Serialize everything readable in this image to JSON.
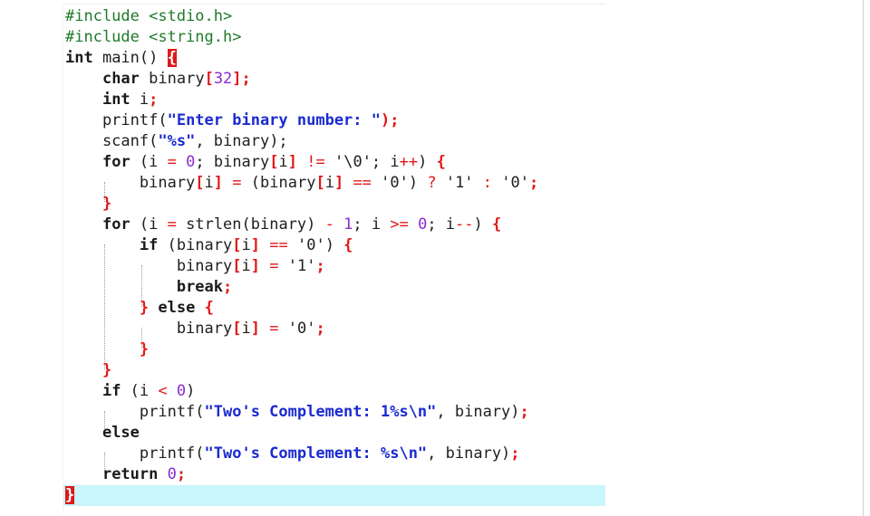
{
  "editor": {
    "lines": [
      [
        {
          "t": "#include <stdio.h>",
          "c": "pp"
        }
      ],
      [
        {
          "t": "#include <string.h>",
          "c": "pp"
        }
      ],
      [
        {
          "t": "int",
          "c": "kw"
        },
        {
          "t": " main() "
        },
        {
          "t": "{",
          "c": "brace-match"
        }
      ],
      [
        {
          "t": "    "
        },
        {
          "t": "char",
          "c": "kw"
        },
        {
          "t": " binary"
        },
        {
          "t": "[",
          "c": "br"
        },
        {
          "t": "32",
          "c": "num"
        },
        {
          "t": "];",
          "c": "br"
        }
      ],
      [
        {
          "t": "    "
        },
        {
          "t": "int",
          "c": "kw"
        },
        {
          "t": " i"
        },
        {
          "t": ";",
          "c": "br"
        }
      ],
      [
        {
          "t": "    printf("
        },
        {
          "t": "\"Enter binary number: \"",
          "c": "str"
        },
        {
          "t": ");",
          "c": "br"
        }
      ],
      [
        {
          "t": "    scanf("
        },
        {
          "t": "\"%s\"",
          "c": "str"
        },
        {
          "t": ", binary);"
        }
      ],
      [
        {
          "t": "    "
        },
        {
          "t": "for",
          "c": "kw"
        },
        {
          "t": " (i "
        },
        {
          "t": "=",
          "c": "op"
        },
        {
          "t": " "
        },
        {
          "t": "0",
          "c": "num"
        },
        {
          "t": "; binary"
        },
        {
          "t": "[",
          "c": "br"
        },
        {
          "t": "i"
        },
        {
          "t": "]",
          "c": "br"
        },
        {
          "t": " "
        },
        {
          "t": "!=",
          "c": "op"
        },
        {
          "t": " '\\0'; i"
        },
        {
          "t": "++",
          "c": "op"
        },
        {
          "t": ") "
        },
        {
          "t": "{",
          "c": "br"
        }
      ],
      [
        {
          "t": "        binary"
        },
        {
          "t": "[",
          "c": "br"
        },
        {
          "t": "i"
        },
        {
          "t": "]",
          "c": "br"
        },
        {
          "t": " "
        },
        {
          "t": "=",
          "c": "op"
        },
        {
          "t": " (binary"
        },
        {
          "t": "[",
          "c": "br"
        },
        {
          "t": "i"
        },
        {
          "t": "]",
          "c": "br"
        },
        {
          "t": " "
        },
        {
          "t": "==",
          "c": "op"
        },
        {
          "t": " '0') "
        },
        {
          "t": "?",
          "c": "op"
        },
        {
          "t": " '1' "
        },
        {
          "t": ":",
          "c": "op"
        },
        {
          "t": " '0'"
        },
        {
          "t": ";",
          "c": "br"
        }
      ],
      [
        {
          "t": "    "
        },
        {
          "t": "}",
          "c": "br"
        }
      ],
      [
        {
          "t": "    "
        },
        {
          "t": "for",
          "c": "kw"
        },
        {
          "t": " (i "
        },
        {
          "t": "=",
          "c": "op"
        },
        {
          "t": " strlen(binary) "
        },
        {
          "t": "-",
          "c": "op"
        },
        {
          "t": " "
        },
        {
          "t": "1",
          "c": "num"
        },
        {
          "t": "; i "
        },
        {
          "t": ">=",
          "c": "op"
        },
        {
          "t": " "
        },
        {
          "t": "0",
          "c": "num"
        },
        {
          "t": "; i"
        },
        {
          "t": "--",
          "c": "op"
        },
        {
          "t": ") "
        },
        {
          "t": "{",
          "c": "br"
        }
      ],
      [
        {
          "t": "        "
        },
        {
          "t": "if",
          "c": "kw"
        },
        {
          "t": " (binary"
        },
        {
          "t": "[",
          "c": "br"
        },
        {
          "t": "i"
        },
        {
          "t": "]",
          "c": "br"
        },
        {
          "t": " "
        },
        {
          "t": "==",
          "c": "op"
        },
        {
          "t": " '0') "
        },
        {
          "t": "{",
          "c": "br"
        }
      ],
      [
        {
          "t": "            binary"
        },
        {
          "t": "[",
          "c": "br"
        },
        {
          "t": "i"
        },
        {
          "t": "]",
          "c": "br"
        },
        {
          "t": " "
        },
        {
          "t": "=",
          "c": "op"
        },
        {
          "t": " '1'"
        },
        {
          "t": ";",
          "c": "br"
        }
      ],
      [
        {
          "t": "            "
        },
        {
          "t": "break",
          "c": "kw"
        },
        {
          "t": ";",
          "c": "br"
        }
      ],
      [
        {
          "t": "        "
        },
        {
          "t": "}",
          "c": "br"
        },
        {
          "t": " "
        },
        {
          "t": "else",
          "c": "kw"
        },
        {
          "t": " "
        },
        {
          "t": "{",
          "c": "br"
        }
      ],
      [
        {
          "t": "            binary"
        },
        {
          "t": "[",
          "c": "br"
        },
        {
          "t": "i"
        },
        {
          "t": "]",
          "c": "br"
        },
        {
          "t": " "
        },
        {
          "t": "=",
          "c": "op"
        },
        {
          "t": " '0'"
        },
        {
          "t": ";",
          "c": "br"
        }
      ],
      [
        {
          "t": "        "
        },
        {
          "t": "}",
          "c": "br"
        }
      ],
      [
        {
          "t": "    "
        },
        {
          "t": "}",
          "c": "br"
        }
      ],
      [
        {
          "t": "    "
        },
        {
          "t": "if",
          "c": "kw"
        },
        {
          "t": " (i "
        },
        {
          "t": "<",
          "c": "op"
        },
        {
          "t": " "
        },
        {
          "t": "0",
          "c": "num"
        },
        {
          "t": ")"
        }
      ],
      [
        {
          "t": "        printf("
        },
        {
          "t": "\"Two's Complement: 1%s\\n\"",
          "c": "str"
        },
        {
          "t": ", binary)"
        },
        {
          "t": ";",
          "c": "br"
        }
      ],
      [
        {
          "t": "    "
        },
        {
          "t": "else",
          "c": "kw"
        }
      ],
      [
        {
          "t": "        printf("
        },
        {
          "t": "\"Two's Complement: %s\\n\"",
          "c": "str"
        },
        {
          "t": ", binary)"
        },
        {
          "t": ";",
          "c": "br"
        }
      ],
      [
        {
          "t": "    "
        },
        {
          "t": "return",
          "c": "kw"
        },
        {
          "t": " "
        },
        {
          "t": "0",
          "c": "num"
        },
        {
          "t": ";",
          "c": "br"
        }
      ],
      [
        {
          "t": "}",
          "c": "brace-match"
        }
      ]
    ],
    "current_line": 23
  }
}
